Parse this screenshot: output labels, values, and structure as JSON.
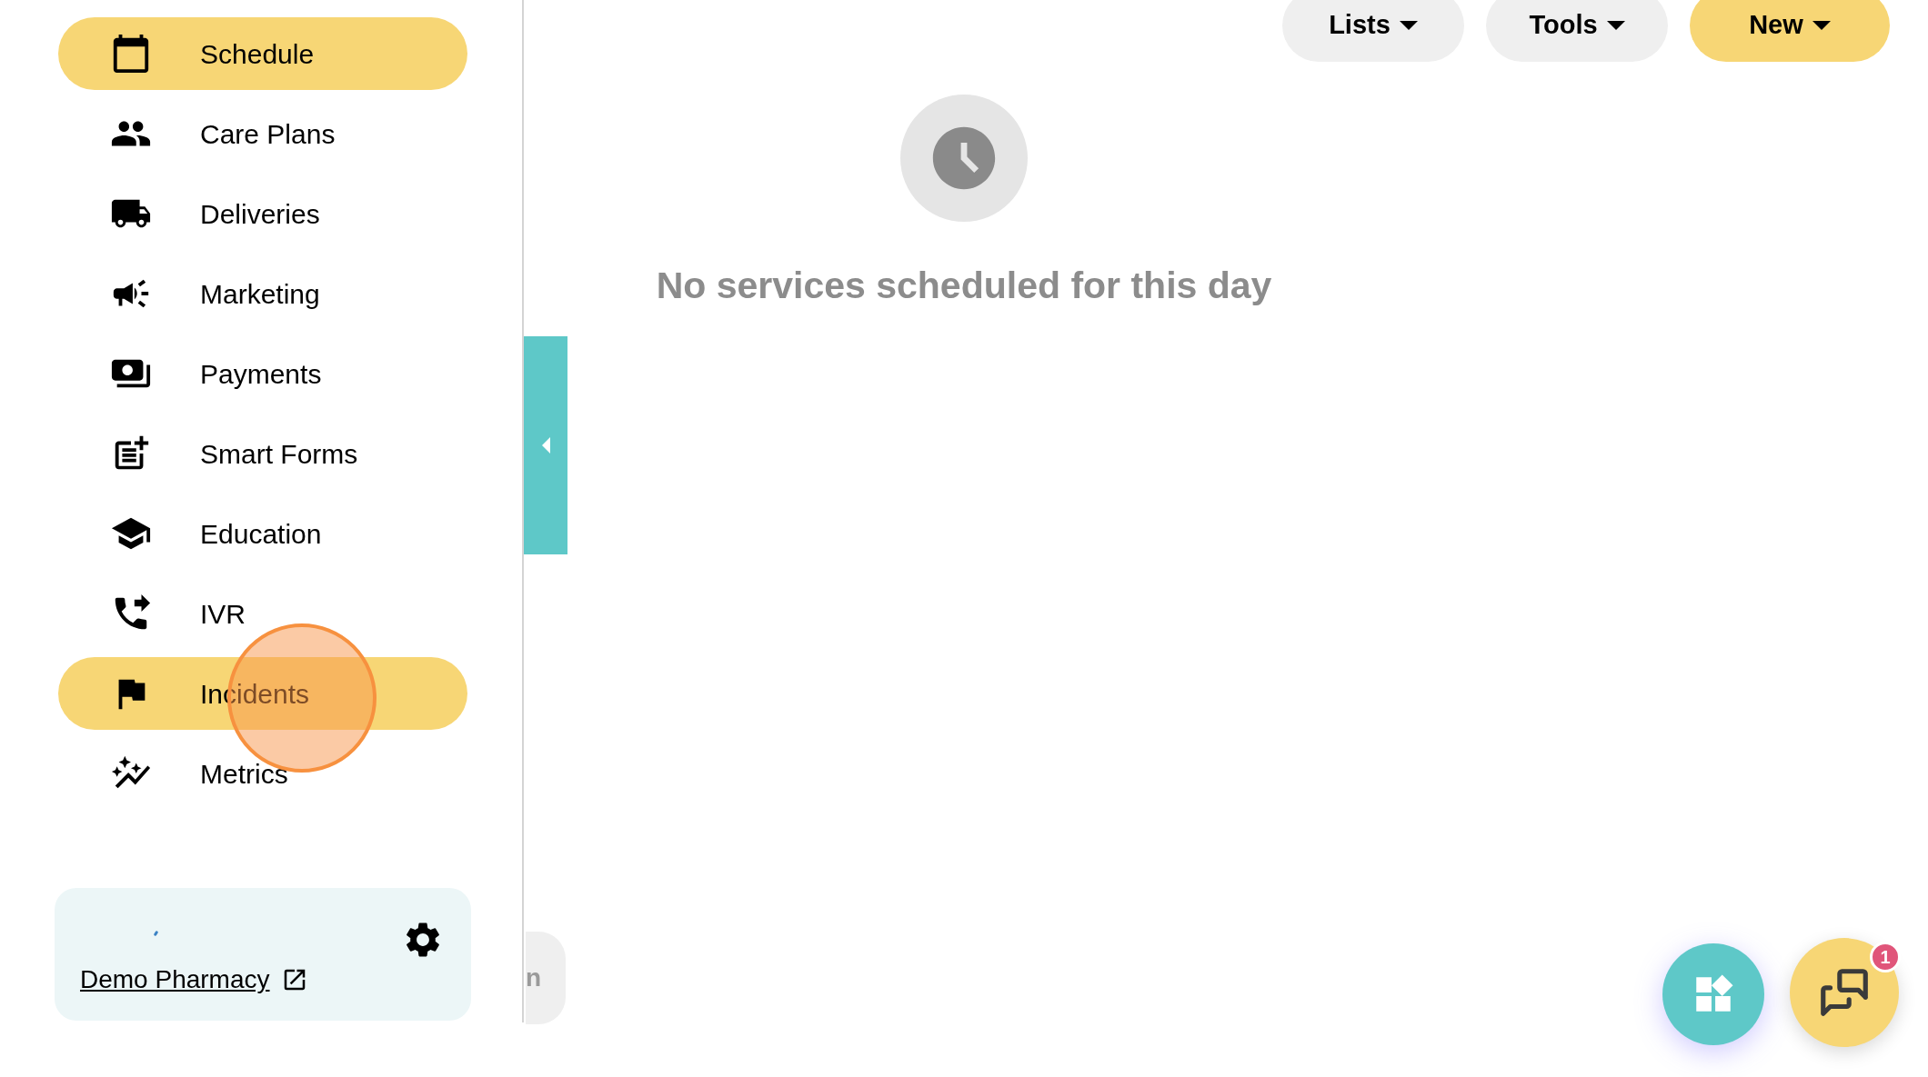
{
  "sidebar": {
    "items": [
      {
        "label": "Schedule",
        "selected": true
      },
      {
        "label": "Care Plans",
        "selected": false
      },
      {
        "label": "Deliveries",
        "selected": false
      },
      {
        "label": "Marketing",
        "selected": false
      },
      {
        "label": "Payments",
        "selected": false
      },
      {
        "label": "Smart Forms",
        "selected": false
      },
      {
        "label": "Education",
        "selected": false
      },
      {
        "label": "IVR",
        "selected": false
      },
      {
        "label": "Incidents",
        "selected": true
      },
      {
        "label": "Metrics",
        "selected": false
      }
    ],
    "account": {
      "name": "Demo Pharmacy"
    },
    "hidden_button": {
      "label": "n"
    }
  },
  "toolbar": {
    "buttons": [
      {
        "label": "Lists",
        "kind": "plain"
      },
      {
        "label": "Tools",
        "kind": "plain"
      },
      {
        "label": "New",
        "kind": "primary"
      }
    ]
  },
  "empty_state": {
    "message": "No services scheduled for this day"
  },
  "chat": {
    "badge": "1"
  }
}
